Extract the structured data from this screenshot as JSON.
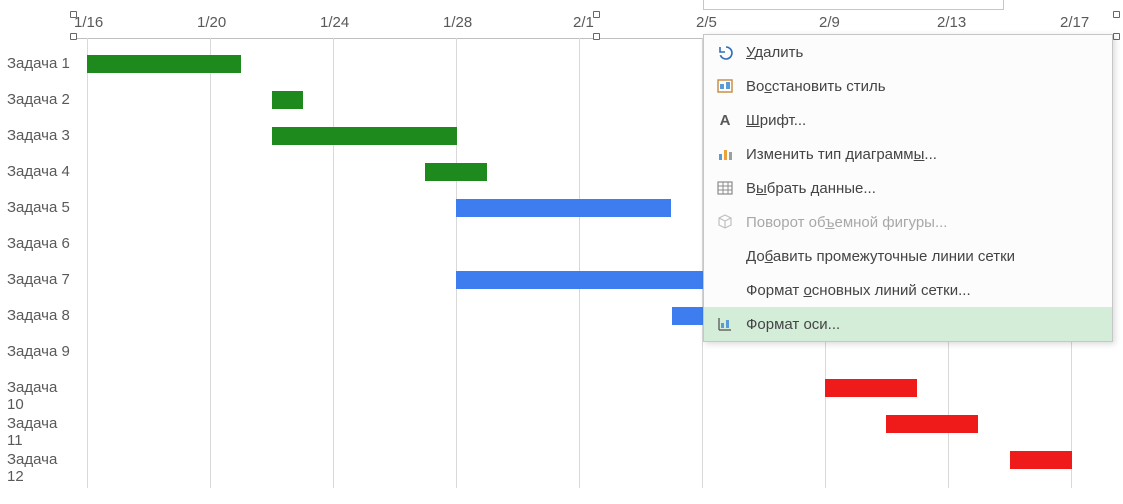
{
  "chart_data": {
    "type": "bar",
    "orientation": "horizontal",
    "title": "",
    "xlabel": "",
    "ylabel": "",
    "x_ticks": [
      "1/16",
      "1/20",
      "1/24",
      "1/28",
      "2/1",
      "2/5",
      "2/9",
      "2/13",
      "2/17"
    ],
    "y_categories": [
      "Задача 1",
      "Задача 2",
      "Задача 3",
      "Задача 4",
      "Задача 5",
      "Задача 6",
      "Задача 7",
      "Задача 8",
      "Задача 9",
      "Задача 10",
      "Задача 11",
      "Задача 12"
    ],
    "bars": [
      {
        "task": "Задача 1",
        "start": "1/16",
        "end": "1/21",
        "color": "green"
      },
      {
        "task": "Задача 2",
        "start": "1/22",
        "end": "1/23",
        "color": "green"
      },
      {
        "task": "Задача 3",
        "start": "1/22",
        "end": "1/28",
        "color": "green"
      },
      {
        "task": "Задача 4",
        "start": "1/27",
        "end": "1/29",
        "color": "green"
      },
      {
        "task": "Задача 5",
        "start": "1/28",
        "end": "2/4",
        "color": "blue"
      },
      {
        "task": "Задача 7",
        "start": "1/28",
        "end": "2/9",
        "color": "blue"
      },
      {
        "task": "Задача 8",
        "start": "2/4",
        "end": "2/5",
        "color": "blue"
      },
      {
        "task": "Задача 10",
        "start": "2/9",
        "end": "2/12",
        "color": "red"
      },
      {
        "task": "Задача 11",
        "start": "2/11",
        "end": "2/14",
        "color": "red"
      },
      {
        "task": "Задача 12",
        "start": "2/15",
        "end": "2/17",
        "color": "red"
      }
    ],
    "xlim": [
      "1/15",
      "2/18"
    ],
    "colors": {
      "green": "#1e8a1e",
      "blue": "#3d7df0",
      "red": "#ef1b1b"
    }
  },
  "menu": {
    "items": [
      {
        "id": "delete",
        "label": "Удалить",
        "u": 0,
        "icon": "undo",
        "disabled": false
      },
      {
        "id": "reset-style",
        "label": "Восстановить стиль",
        "u": 2,
        "icon": "reset",
        "disabled": false
      },
      {
        "id": "font",
        "label": "Шрифт...",
        "u": 0,
        "icon": "font",
        "disabled": false
      },
      {
        "id": "change-type",
        "label": "Изменить тип диаграммы...",
        "u": -1,
        "underline_char": "ы",
        "icon": "chart",
        "disabled": false
      },
      {
        "id": "select-data",
        "label": "Выбрать данные...",
        "u": 1,
        "icon": "data",
        "disabled": false
      },
      {
        "id": "rotate-3d",
        "label": "Поворот объемной фигуры...",
        "u": -1,
        "underline_char": "ъ",
        "icon": "cube",
        "disabled": true
      },
      {
        "id": "add-minor-grid",
        "label": "Добавить промежуточные линии сетки",
        "u": 2,
        "icon": "",
        "disabled": false
      },
      {
        "id": "format-major-grid",
        "label": "Формат основных линий сетки...",
        "u": 7,
        "icon": "",
        "disabled": false
      },
      {
        "id": "format-axis",
        "label": "Формат оси...",
        "u": -1,
        "icon": "axis",
        "disabled": false,
        "hover": true
      }
    ]
  }
}
